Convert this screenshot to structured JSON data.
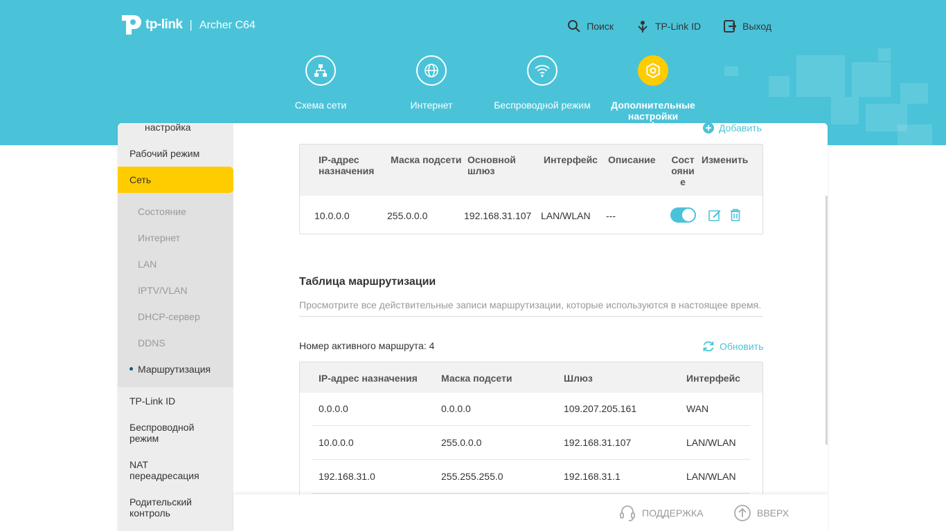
{
  "header": {
    "brand": "tp-link",
    "separator": "|",
    "model": "Archer C64",
    "links": [
      {
        "label": "Поиск",
        "icon": "search-icon"
      },
      {
        "label": "TP-Link ID",
        "icon": "tplink-id-icon"
      },
      {
        "label": "Выход",
        "icon": "logout-icon"
      }
    ],
    "nav": [
      {
        "label": "Схема сети",
        "icon": "network-map-icon"
      },
      {
        "label": "Интернет",
        "icon": "globe-icon"
      },
      {
        "label": "Беспроводной режим",
        "icon": "wifi-icon"
      },
      {
        "label": "Дополнительные настройки",
        "icon": "gear-icon",
        "active": true
      }
    ]
  },
  "sidebar": {
    "partial_top": "настройка",
    "items_before": [
      "Рабочий режим"
    ],
    "active": "Сеть",
    "sub": [
      "Состояние",
      "Интернет",
      "LAN",
      "IPTV/VLAN",
      "DHCP-сервер",
      "DDNS",
      "Маршрутизация"
    ],
    "sub_active_index": 6,
    "items_after": [
      "TP-Link ID",
      "Беспроводной режим",
      "NAT переадресация",
      "Родительский контроль"
    ]
  },
  "static_routes": {
    "add_label": "Добавить",
    "headers": [
      "IP-адрес назначения",
      "Маска подсети",
      "Основной шлюз",
      "Интерфейс",
      "Описание",
      "Состояние",
      "Изменить"
    ],
    "headers_wrapped": {
      "dest": "IP-адрес назначения",
      "gateway": "Основной шлюз",
      "status": "Сост ояни е"
    },
    "rows": [
      {
        "dest": "10.0.0.0",
        "mask": "255.0.0.0",
        "gateway": "192.168.31.107",
        "iface": "LAN/WLAN",
        "desc": "---",
        "enabled": true
      }
    ]
  },
  "routing_table": {
    "title": "Таблица маршрутизации",
    "description": "Просмотрите все действительные записи маршрутизации, которые используются в настоящее время.",
    "active_count_label": "Номер активного маршрута: 4",
    "refresh_label": "Обновить",
    "headers": [
      "IP-адрес назначения",
      "Маска подсети",
      "Шлюз",
      "Интерфейс"
    ],
    "rows": [
      [
        "0.0.0.0",
        "0.0.0.0",
        "109.207.205.161",
        "WAN"
      ],
      [
        "10.0.0.0",
        "255.0.0.0",
        "192.168.31.107",
        "LAN/WLAN"
      ],
      [
        "192.168.31.0",
        "255.255.255.0",
        "192.168.31.1",
        "LAN/WLAN"
      ]
    ]
  },
  "footer": {
    "support": "ПОДДЕРЖКА",
    "top": "ВВЕРХ"
  },
  "colors": {
    "header_bg": "#4ac3d9",
    "accent_yellow": "#ffcc00",
    "link_blue": "#4ac3d9"
  }
}
